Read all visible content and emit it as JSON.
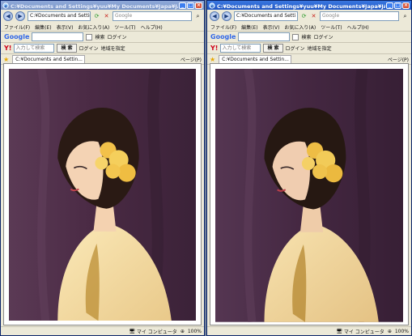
{
  "windows": [
    {
      "title": "C:¥Documents and Settings¥yuu¥My Documents¥Japa¥JAGATでの比較用写真…",
      "address": "C:¥Documents and Settings",
      "search_placeholder": "Google",
      "menu": [
        "ファイル(F)",
        "編集(E)",
        "表示(V)",
        "お気に入り(A)",
        "ツール(T)",
        "ヘルプ(H)"
      ],
      "google_toolbar": {
        "logo": "Google",
        "search_label": "検索",
        "login_label": "ログイン"
      },
      "yahoo_toolbar": {
        "logo": "Y!",
        "input_placeholder": "入力して検索",
        "search_button": "検 索",
        "login_label": "ログイン",
        "map_label": "地域を指定"
      },
      "tab_label": "C:¥Documents and Settin...",
      "page_label": "ページ(P)",
      "status": {
        "zone": "マイ コンピュータ",
        "zoom": "100%"
      }
    },
    {
      "title": "C:¥Documents and Settings¥yuu¥My Documents¥Japa¥JAGATでの比較用写真¥…",
      "address": "C:¥Documents and Setti",
      "search_placeholder": "Google",
      "menu": [
        "ファイル(F)",
        "編集(E)",
        "表示(V)",
        "お気に入り(A)",
        "ツール(T)",
        "ヘルプ(H)"
      ],
      "google_toolbar": {
        "logo": "Google",
        "search_label": "検索",
        "login_label": "ログイン"
      },
      "yahoo_toolbar": {
        "logo": "Y!",
        "input_placeholder": "入力して検索",
        "search_button": "検 索",
        "login_label": "ログイン",
        "map_label": "地域を指定"
      },
      "tab_label": "C:¥Documents and Settin...",
      "page_label": "ページ(P)",
      "status": {
        "zone": "マイ コンピュータ",
        "zoom": "100%"
      }
    }
  ],
  "colors": {
    "title_active": "#1f55c4",
    "photo_background": "#4a2a44",
    "dress": "#f3dca0",
    "flowers": "#f2c14a"
  },
  "icons": [
    "ie-icon",
    "back-icon",
    "forward-icon",
    "refresh-icon",
    "stop-icon",
    "search-icon",
    "star-icon",
    "computer-icon",
    "zoom-icon"
  ]
}
